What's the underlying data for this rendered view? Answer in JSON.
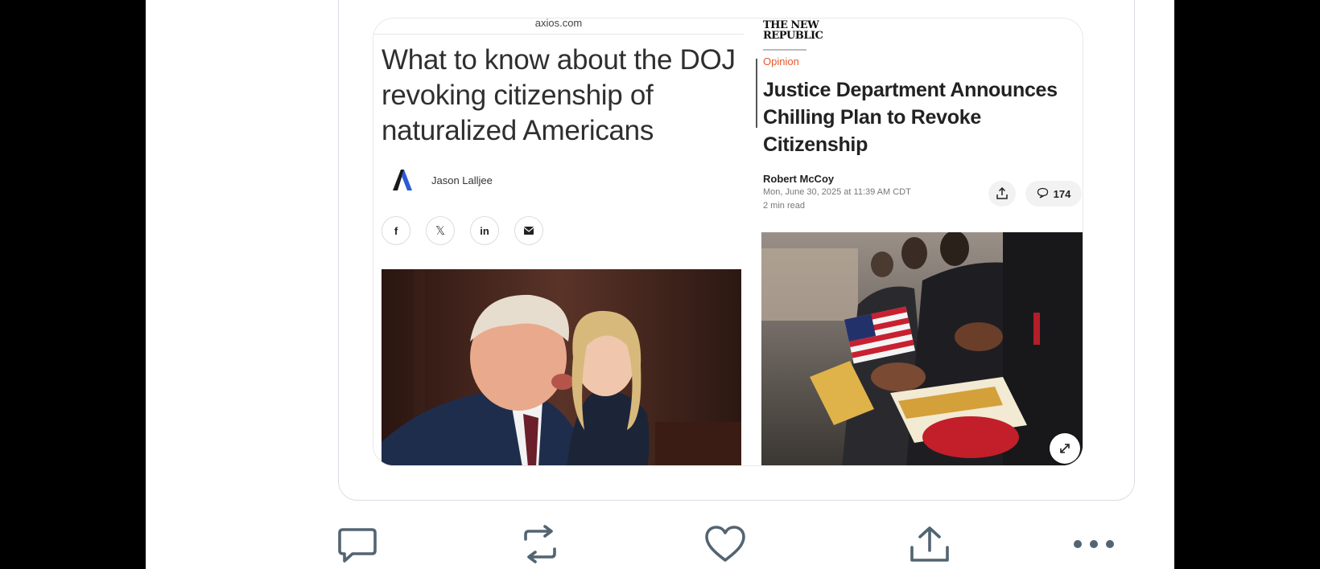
{
  "axios_panel": {
    "domain": "axios.com",
    "headline": "What to know about the DOJ revoking citizenship of naturalized Americans",
    "author": "Jason Lalljee",
    "share_icons": [
      "facebook-icon",
      "x-icon",
      "linkedin-icon",
      "email-icon"
    ],
    "share_glyphs": {
      "facebook": "f",
      "x": "𝕏",
      "linkedin": "in"
    }
  },
  "tnr_panel": {
    "logo_text_line1": "THE NEW",
    "logo_text_line2": "REPUBLIC",
    "kicker": "Opinion",
    "headline": "Justice Department Announces Chilling Plan to Revoke Citizenship",
    "author": "Robert McCoy",
    "date": "Mon, June 30, 2025 at 11:39 AM CDT",
    "read_time": "2 min read",
    "comment_count": "174"
  },
  "tweet_actions": [
    {
      "name": "reply-icon"
    },
    {
      "name": "retweet-icon"
    },
    {
      "name": "like-icon"
    },
    {
      "name": "share-icon"
    },
    {
      "name": "more-icon"
    }
  ],
  "colors": {
    "action_icon": "#536471",
    "kicker": "#e55a2b",
    "axios_logo": "#2a5bd7"
  }
}
